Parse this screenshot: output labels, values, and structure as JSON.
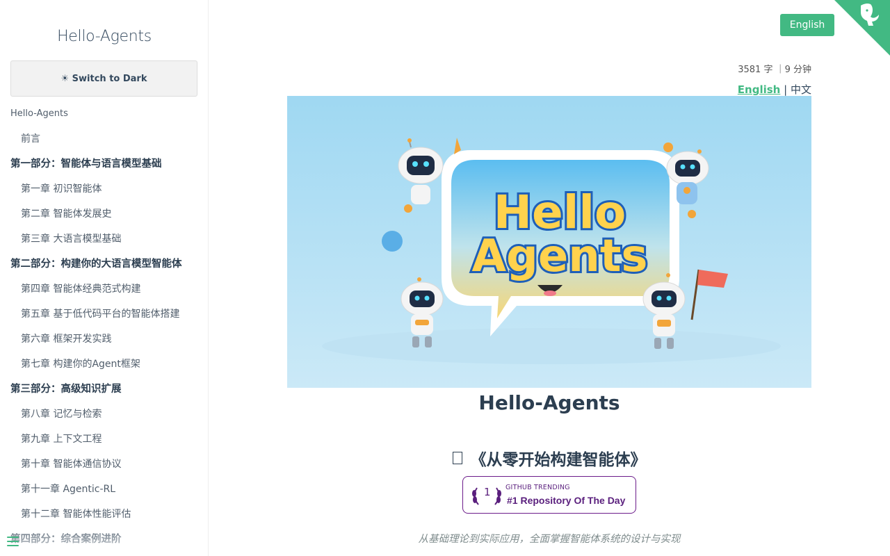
{
  "sidebar": {
    "app_name": "Hello-Agents",
    "theme_toggle": "☀ Switch to Dark",
    "items": [
      {
        "label": "Hello-Agents",
        "kind": "root"
      },
      {
        "label": "前言",
        "kind": "child"
      },
      {
        "label": "第一部分：智能体与语言模型基础",
        "kind": "section"
      },
      {
        "label": "第一章 初识智能体",
        "kind": "child"
      },
      {
        "label": "第二章 智能体发展史",
        "kind": "child"
      },
      {
        "label": "第三章 大语言模型基础",
        "kind": "child"
      },
      {
        "label": "第二部分：构建你的大语言模型智能体",
        "kind": "section"
      },
      {
        "label": "第四章 智能体经典范式构建",
        "kind": "child"
      },
      {
        "label": "第五章 基于低代码平台的智能体搭建",
        "kind": "child"
      },
      {
        "label": "第六章 框架开发实践",
        "kind": "child"
      },
      {
        "label": "第七章 构建你的Agent框架",
        "kind": "child"
      },
      {
        "label": "第三部分：高级知识扩展",
        "kind": "section"
      },
      {
        "label": "第八章 记忆与检索",
        "kind": "child"
      },
      {
        "label": "第九章 上下文工程",
        "kind": "child"
      },
      {
        "label": "第十章 智能体通信协议",
        "kind": "child"
      },
      {
        "label": "第十一章 Agentic-RL",
        "kind": "child"
      },
      {
        "label": "第十二章 智能体性能评估",
        "kind": "child"
      },
      {
        "label": "第四部分：综合案例进阶",
        "kind": "section"
      }
    ]
  },
  "header": {
    "language_button": "English",
    "meta": "3581 字 ｜9 分钟",
    "lang_link_en": "English",
    "lang_separator": "|",
    "lang_link_zh": "中文"
  },
  "hero": {
    "logo_line1": "Hello",
    "logo_line2": "Agents"
  },
  "content": {
    "title": "Hello-Agents",
    "subtitle": "《从零开始构建智能体》",
    "badge": {
      "rank": "1",
      "small": "GITHUB TRENDING",
      "big": "#1 Repository Of The Day"
    },
    "tagline": "从基础理论到实际应用，全面掌握智能体系统的设计与实现"
  },
  "colors": {
    "accent": "#42b983",
    "text": "#34495e",
    "badge": "#5a1f7d"
  }
}
